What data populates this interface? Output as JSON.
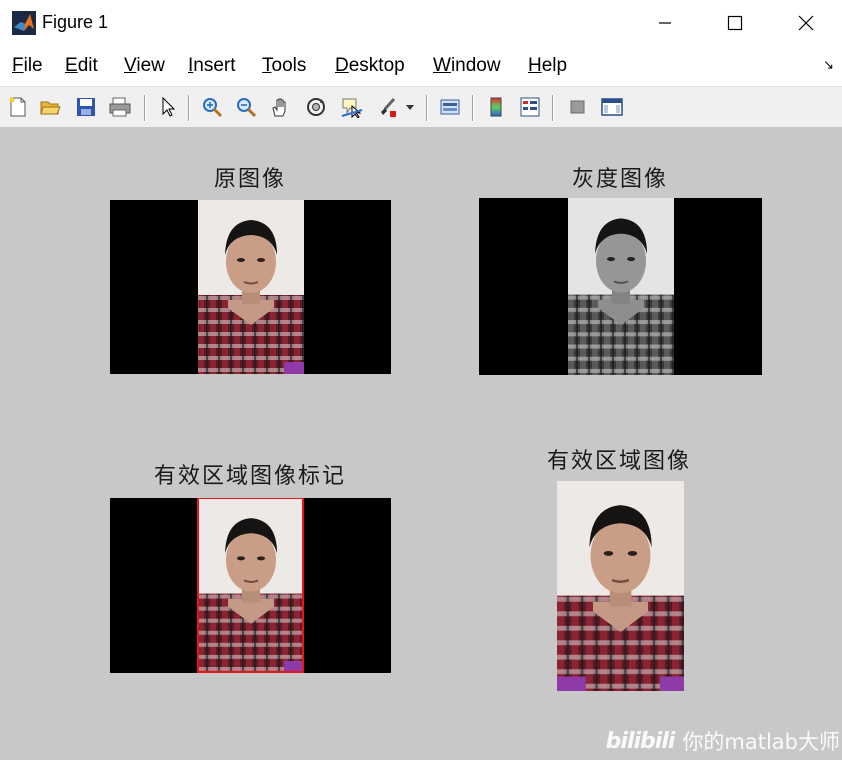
{
  "window": {
    "title": "Figure 1"
  },
  "menubar": {
    "items": [
      {
        "mnemonic": "F",
        "rest": "ile"
      },
      {
        "mnemonic": "E",
        "rest": "dit"
      },
      {
        "mnemonic": "V",
        "rest": "iew"
      },
      {
        "mnemonic": "I",
        "rest": "nsert"
      },
      {
        "mnemonic": "T",
        "rest": "ools"
      },
      {
        "mnemonic": "D",
        "rest": "esktop"
      },
      {
        "mnemonic": "W",
        "rest": "indow"
      },
      {
        "mnemonic": "H",
        "rest": "elp"
      }
    ],
    "dock_glyph": "↘"
  },
  "toolbar": {
    "icons": [
      "new-figure-icon",
      "open-file-icon",
      "save-icon",
      "print-icon",
      "select-pointer-icon",
      "zoom-in-icon",
      "zoom-out-icon",
      "pan-hand-icon",
      "rotate-3d-icon",
      "data-cursor-icon",
      "brush-icon",
      "brush-dropdown-icon",
      "link-plot-icon",
      "colorbar-icon",
      "legend-icon",
      "hide-plot-tools-icon",
      "show-plot-tools-icon"
    ]
  },
  "subplots": {
    "original_title": "原图像",
    "gray_title": "灰度图像",
    "marked_title": "有效区域图像标记",
    "roi_title": "有效区域图像"
  },
  "colors": {
    "figure_background": "#c8c8c8",
    "roi_marker": "#e8141c",
    "image_padding": "#000000"
  },
  "watermark": {
    "logo": "bilibili",
    "text": "你的matlab大师"
  }
}
